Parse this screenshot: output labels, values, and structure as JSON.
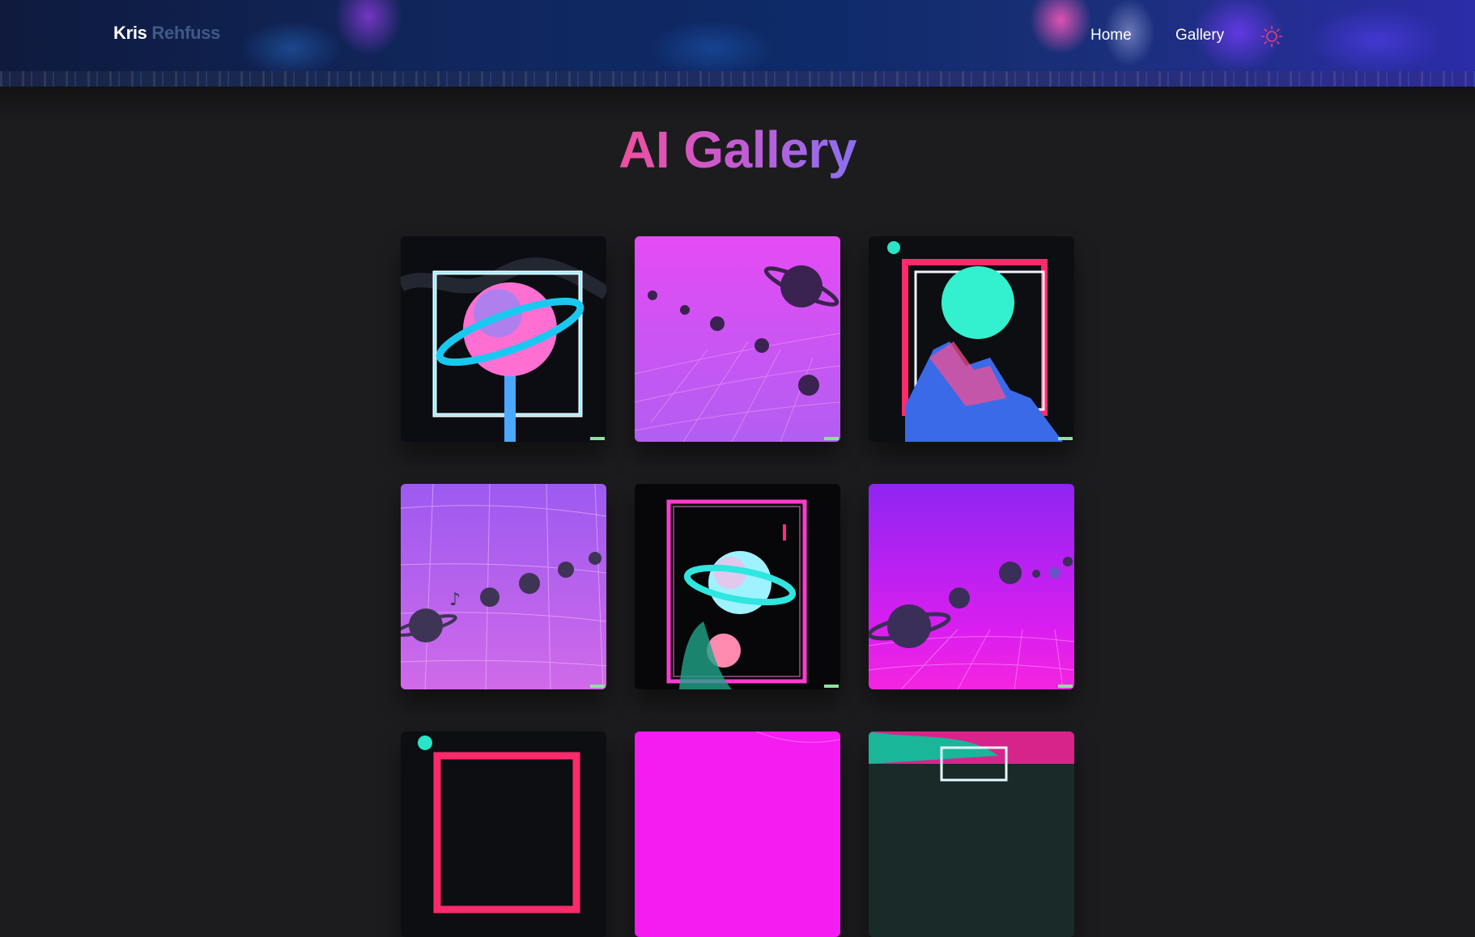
{
  "brand": {
    "first": "Kris",
    "last": "Rehfuss"
  },
  "nav": [
    {
      "label": "Home"
    },
    {
      "label": "Gallery"
    }
  ],
  "theme_toggle_icon": "sun-icon",
  "page": {
    "title": "AI Gallery"
  },
  "colors": {
    "background": "#1c1c1e",
    "title_gradient_start": "#ef4f9d",
    "title_gradient_end": "#8a6ff0",
    "sun_icon": "#e8407a",
    "brand_last": "#3f5a86"
  },
  "gallery": {
    "images": [
      {
        "subject": "ringed planet in neon frame, dark background"
      },
      {
        "subject": "planets over pink grid"
      },
      {
        "subject": "teal planet in red frame"
      },
      {
        "subject": "planets over purple grid"
      },
      {
        "subject": "teal ringed planet in pink frame"
      },
      {
        "subject": "planets over magenta grid"
      },
      {
        "subject": "teal orb with red frame"
      },
      {
        "subject": "magenta grid"
      },
      {
        "subject": "teal and pink planet"
      }
    ]
  }
}
